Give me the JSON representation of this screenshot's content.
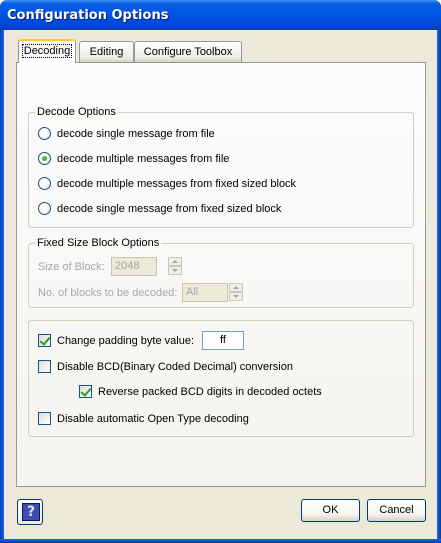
{
  "window": {
    "title": "Configuration Options"
  },
  "tabs": [
    {
      "label": "Decoding",
      "active": true
    },
    {
      "label": "Editing",
      "active": false
    },
    {
      "label": "Configure Toolbox",
      "active": false
    }
  ],
  "decode_options": {
    "legend": "Decode Options",
    "options": [
      {
        "label": "decode single message from file",
        "checked": false
      },
      {
        "label": "decode multiple messages from file",
        "checked": true
      },
      {
        "label": "decode multiple messages from fixed sized block",
        "checked": false
      },
      {
        "label": "decode single message from fixed sized block",
        "checked": false
      }
    ]
  },
  "fixed_block": {
    "legend": "Fixed Size Block Options",
    "size_label": "Size of Block:",
    "size_value": "2048",
    "count_label": "No. of blocks to be decoded:",
    "count_value": "All",
    "enabled": false
  },
  "options": {
    "change_padding_label": "Change padding byte value:",
    "change_padding_checked": true,
    "padding_value": "ff",
    "disable_bcd_label": "Disable BCD(Binary Coded Decimal) conversion",
    "disable_bcd_checked": false,
    "reverse_bcd_label": "Reverse packed BCD digits in decoded octets",
    "reverse_bcd_checked": true,
    "disable_open_type_label": "Disable automatic Open Type decoding",
    "disable_open_type_checked": false
  },
  "buttons": {
    "help_glyph": "?",
    "ok_label": "OK",
    "cancel_label": "Cancel"
  },
  "colors": {
    "titlebar": "#0055e5",
    "dialog_bg": "#ece9d8",
    "tab_highlight": "#ffc83c",
    "check_green": "#21a121"
  },
  "icons": {
    "help": "help-question-icon"
  }
}
